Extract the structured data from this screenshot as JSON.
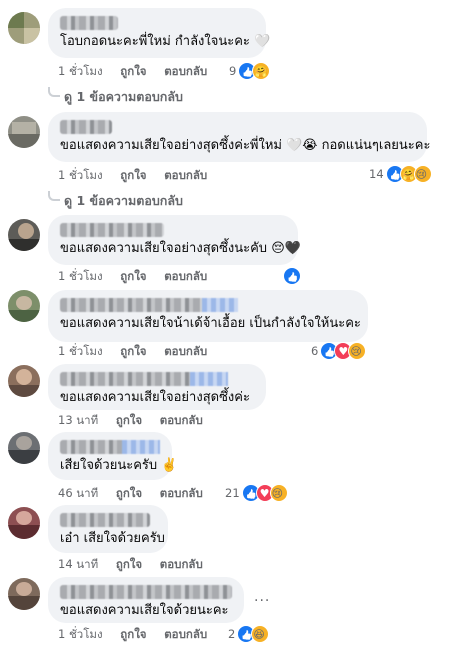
{
  "labels": {
    "like": "ถูกใจ",
    "reply": "ตอบกลับ"
  },
  "comments": [
    {
      "text": "โอบกอดนะคะพี่ใหม่ กำลังใจนะคะ 🤍",
      "time": "1 ชั่วโมง",
      "count": "9",
      "reactions": [
        "like",
        "care"
      ],
      "replies": "ดู 1 ข้อความตอบกลับ"
    },
    {
      "text": "ขอแสดงความเสียใจอย่างสุดซึ้งค่ะพี่ใหม่ 🤍😭 กอดแน่นๆเลยนะคะ",
      "time": "1 ชั่วโมง",
      "count": "14",
      "reactions": [
        "like",
        "care",
        "sad"
      ],
      "replies": "ดู 1 ข้อความตอบกลับ"
    },
    {
      "text": "ขอแสดงความเสียใจอย่างสุดซึ้งนะคับ 😔🖤",
      "time": "1 ชั่วโมง",
      "count": "",
      "reactions": [
        "like"
      ]
    },
    {
      "text": "ขอแสดงความเสียใจน้าเด้จ้าเอื้อย เป็นกำลังใจให้นะคะ",
      "time": "1 ชั่วโมง",
      "count": "6",
      "reactions": [
        "like",
        "love",
        "sad"
      ]
    },
    {
      "text": "ขอแสดงความเสียใจอย่างสุดซึ้งค่ะ",
      "time": "13 นาที",
      "count": "",
      "reactions": []
    },
    {
      "text": "เสียใจด้วยนะครับ ✌️",
      "time": "46 นาที",
      "count": "21",
      "reactions": [
        "like",
        "love",
        "sad"
      ]
    },
    {
      "text": "เอ๋า เสียใจด้วยครับ",
      "time": "14 นาที",
      "count": "",
      "reactions": []
    },
    {
      "text": "ขอแสดงความเสียใจด้วยนะคะ",
      "time": "1 ชั่วโมง",
      "count": "2",
      "reactions": [
        "like",
        "haha"
      ],
      "more": "..."
    }
  ]
}
